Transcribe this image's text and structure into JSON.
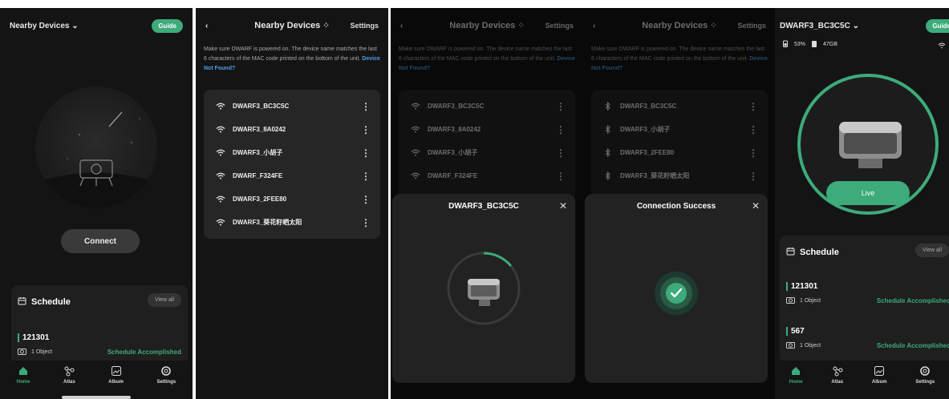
{
  "screen1": {
    "header_title": "Nearby Devices",
    "guide_label": "Guide",
    "connect_label": "Connect",
    "schedule": {
      "title": "Schedule",
      "view_all": "View all",
      "items": [
        {
          "id": "121301",
          "objects": "1 Object",
          "status": "Schedule Accomplished"
        }
      ]
    }
  },
  "nearby": {
    "title": "Nearby Devices",
    "settings_label": "Settings",
    "hint": "Make sure DWARF is powered on. The device name matches the last 6 characters of the MAC code printed on the bottom of the unit.",
    "hint_link": "Device Not Found?"
  },
  "devices_wifi": [
    "DWARF3_BC3C5C",
    "DWARF3_8A0242",
    "DWARF3_小胡子",
    "DWARF_F324FE",
    "DWARF3_2FEE80",
    "DWARF3_葵花籽晒太阳"
  ],
  "devices_screen3": [
    "DWARF3_BC3C5C",
    "DWARF3_8A0242",
    "DWARF3_小胡子",
    "DWARF_F324FE",
    "DWARF3_2FEE80"
  ],
  "devices_bt": [
    "DWARF3_BC3C5C",
    "DWARF3_小胡子",
    "DWARF3_2FEE80",
    "DWARF3_葵花籽晒太阳",
    "DWARF3_2FEE80"
  ],
  "modal_connecting": {
    "title": "DWARF3_BC3C5C"
  },
  "modal_success": {
    "title": "Connection Success"
  },
  "screen5": {
    "header_title": "DWARF3_BC3C5C",
    "guide_label": "Guide",
    "battery": "53%",
    "storage": "47GB",
    "live_label": "Live",
    "schedule": {
      "title": "Schedule",
      "view_all": "View all",
      "items": [
        {
          "id": "121301",
          "objects": "1 Object",
          "status": "Schedule Accomplished"
        },
        {
          "id": "567",
          "objects": "1 Object",
          "status": "Schedule Accomplished"
        }
      ]
    }
  },
  "tabs": [
    {
      "label": "Home",
      "icon": "home-icon"
    },
    {
      "label": "Atlas",
      "icon": "atlas-icon"
    },
    {
      "label": "Album",
      "icon": "album-icon"
    },
    {
      "label": "Settings",
      "icon": "settings-icon"
    }
  ],
  "colors": {
    "accent": "#3dab7a",
    "link": "#4c9fe8",
    "background": "#141414"
  }
}
